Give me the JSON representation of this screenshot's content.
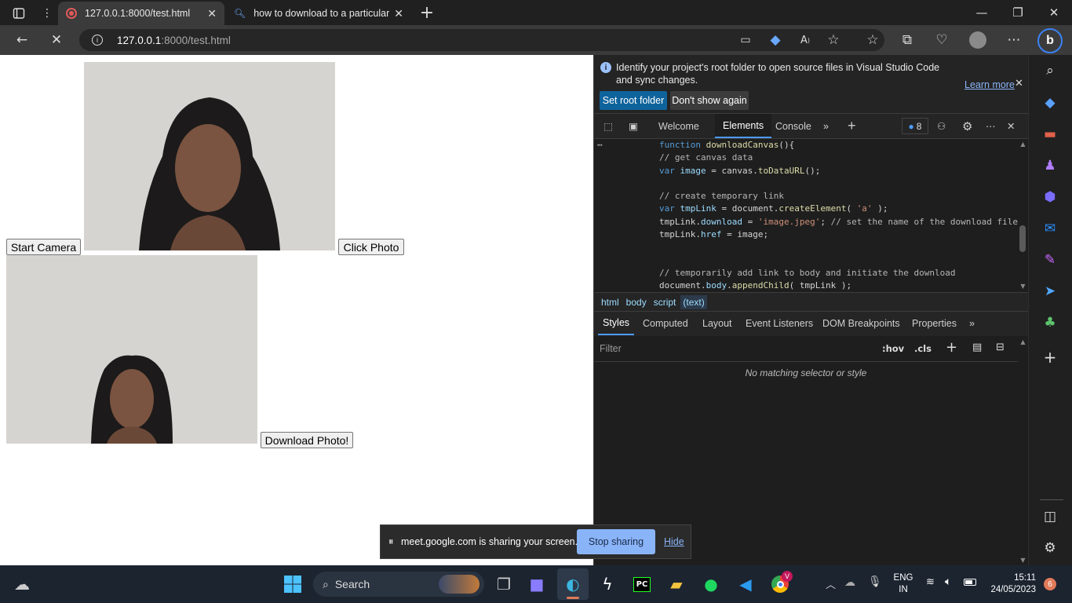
{
  "tabs": [
    {
      "title": "127.0.0.1:8000/test.html",
      "active": true
    },
    {
      "title": "how to download to a particular",
      "active": false
    }
  ],
  "omnibox": {
    "host": "127.0.0.1",
    "path": ":8000/test.html"
  },
  "page": {
    "start_camera": "Start Camera",
    "click_photo": "Click Photo",
    "download_photo": "Download Photo!"
  },
  "devtools": {
    "infobar": {
      "message": "Identify your project's root folder to open source files in Visual Studio Code and sync changes.",
      "learn_more": "Learn more",
      "set_root": "Set root folder",
      "dont_show": "Don't show again"
    },
    "tabs": [
      "Welcome",
      "Elements",
      "Console"
    ],
    "issues_count": "8",
    "code_lines": [
      {
        "t": "function downloadCanvas(){"
      },
      {
        "t": "// get canvas data"
      },
      {
        "t": "var image = canvas.toDataURL();"
      },
      {
        "t": ""
      },
      {
        "t": "// create temporary link"
      },
      {
        "t": "var tmpLink = document.createElement( 'a' );"
      },
      {
        "t": "tmpLink.download = 'image.jpeg'; // set the name of the download file"
      },
      {
        "t": "tmpLink.href = image;"
      },
      {
        "t": ""
      },
      {
        "t": ""
      },
      {
        "t": "// temporarily add link to body and initiate the download"
      },
      {
        "t": "document.body.appendChild( tmpLink );"
      }
    ],
    "breadcrumbs": [
      "html",
      "body",
      "script",
      "(text)"
    ],
    "styles_tabs": [
      "Styles",
      "Computed",
      "Layout",
      "Event Listeners",
      "DOM Breakpoints",
      "Properties"
    ],
    "filter_placeholder": "Filter",
    "hov": ":hov",
    "cls": ".cls",
    "no_match": "No matching selector or style"
  },
  "sharebar": {
    "message": "meet.google.com is sharing your screen.",
    "stop": "Stop sharing",
    "hide": "Hide"
  },
  "taskbar": {
    "search": "Search",
    "lang_top": "ENG",
    "lang_bottom": "IN",
    "time": "15:11",
    "date": "24/05/2023",
    "notif_count": "6",
    "chrome_badge": "V"
  },
  "colors": {
    "accent": "#4d9cff",
    "stop_button": "#8ab4f8",
    "set_root_button": "#0e639c"
  }
}
